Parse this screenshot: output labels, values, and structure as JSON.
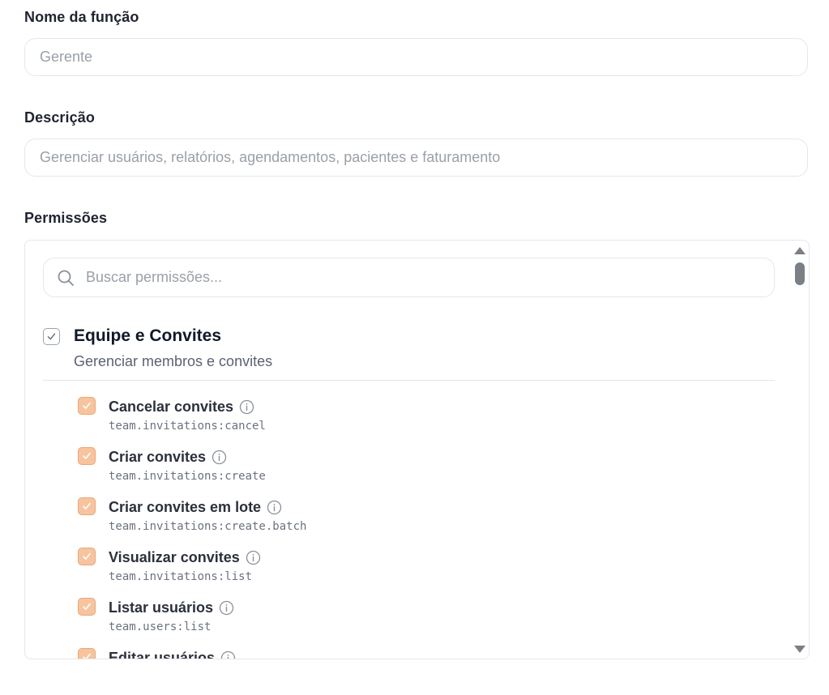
{
  "form": {
    "name_label": "Nome da função",
    "name_placeholder": "Gerente",
    "description_label": "Descrição",
    "description_placeholder": "Gerenciar usuários, relatórios, agendamentos, pacientes e faturamento",
    "permissions_label": "Permissões"
  },
  "permissions": {
    "search_placeholder": "Buscar permissões...",
    "group": {
      "title": "Equipe e Convites",
      "description": "Gerenciar membros e convites",
      "checked": true
    },
    "items": [
      {
        "label": "Cancelar convites",
        "code": "team.invitations:cancel",
        "checked": true
      },
      {
        "label": "Criar convites",
        "code": "team.invitations:create",
        "checked": true
      },
      {
        "label": "Criar convites em lote",
        "code": "team.invitations:create.batch",
        "checked": true
      },
      {
        "label": "Visualizar convites",
        "code": "team.invitations:list",
        "checked": true
      },
      {
        "label": "Listar usuários",
        "code": "team.users:list",
        "checked": true
      },
      {
        "label": "Editar usuários",
        "code": "",
        "checked": true
      }
    ]
  },
  "icons": {
    "search": "search-icon",
    "info": "info-icon",
    "check": "check-icon",
    "scroll_up": "scroll-up-arrow",
    "scroll_down": "scroll-down-arrow"
  },
  "colors": {
    "checkbox_fill": "#f7c49f",
    "checkbox_border": "#e9a77a",
    "checkmark": "#ffffff",
    "border": "#e5e7eb",
    "placeholder": "#9aa0a8",
    "scrollbar": "#7b7f86"
  }
}
